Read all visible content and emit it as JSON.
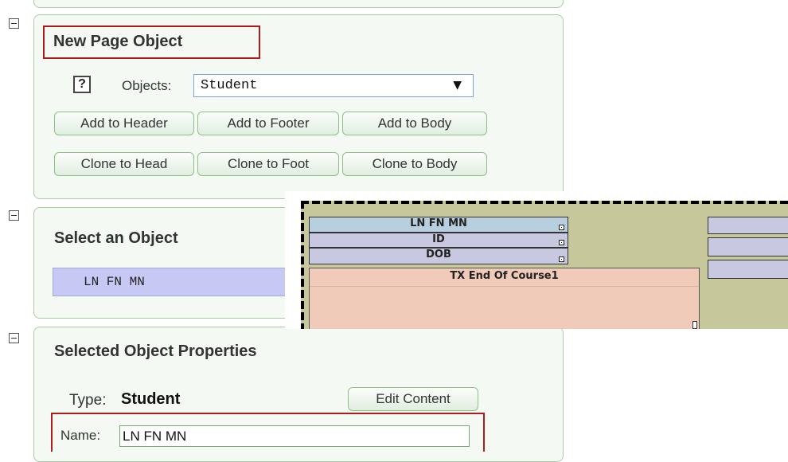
{
  "new_page_object": {
    "title": "New Page Object",
    "help": "?",
    "objects_label": "Objects:",
    "objects_value": "Student",
    "dropdown_arrow": "▼",
    "buttons": {
      "add_header": "Add to Header",
      "add_footer": "Add to Footer",
      "add_body": "Add to Body",
      "clone_head": "Clone to Head",
      "clone_foot": "Clone to Foot",
      "clone_body": "Clone to Body"
    }
  },
  "select_object": {
    "title": "Select an Object",
    "selected_item": "LN FN MN"
  },
  "canvas": {
    "fields": [
      "LN FN MN",
      "ID",
      "DOB"
    ],
    "course_block": "TX End Of Course1"
  },
  "selected_properties": {
    "title": "Selected Object Properties",
    "type_label": "Type:",
    "type_value": "Student",
    "edit_button": "Edit Content",
    "name_label": "Name:",
    "name_value": "LN FN MN"
  },
  "colors": {
    "panel_border": "#a9cfa0",
    "highlight": "#b01c1c",
    "field_blue": "#b8cfe0",
    "field_lavender": "#c8c8e0",
    "course_pink": "#f1cbb9",
    "canvas_bg": "#c7c79c",
    "list_selected": "#c8c8f4"
  }
}
